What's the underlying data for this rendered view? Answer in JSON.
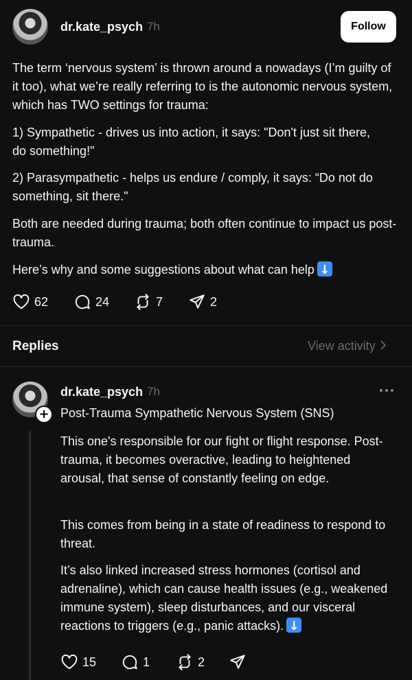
{
  "post": {
    "username": "dr.kate_psych",
    "time": "7h",
    "follow_label": "Follow",
    "paragraphs": [
      "The term ‘nervous system’ is thrown around a nowadays (I’m guilty of it too), what we’re really referring to is the autonomic nervous system, which has TWO settings for trauma:",
      "1) Sympathetic - drives us into action, it says: \"Don't just sit there, do something!\"",
      "2) Parasympathetic - helps us endure / comply, it says: “Do not do something, sit there.\"",
      "Both are needed during trauma; both often continue to impact us post-trauma.",
      "Here’s why and some suggestions about what can help"
    ],
    "actions": {
      "likes": "62",
      "comments": "24",
      "reposts": "7",
      "shares": "2"
    }
  },
  "replies_header": {
    "title": "Replies",
    "view_activity": "View activity"
  },
  "reply": {
    "username": "dr.kate_psych",
    "time": "7h",
    "title": "Post-Trauma Sympathetic Nervous System (SNS)",
    "paragraphs": [
      "This one's responsible for our fight or flight response. Post-trauma, it becomes overactive, leading to heightened arousal, that sense of constantly feeling on edge.",
      "This comes from being in a state of readiness to respond to threat.",
      "It’s also linked increased stress hormones (cortisol and adrenaline), which can cause health issues (e.g., weakened immune system), sleep disturbances, and our visceral reactions to triggers (e.g., panic attacks)."
    ],
    "actions": {
      "likes": "15",
      "comments": "1",
      "reposts": "2"
    }
  },
  "icons": [
    "heart-icon",
    "comment-icon",
    "repost-icon",
    "share-icon",
    "down-arrow-emoji-icon",
    "plus-icon",
    "more-icon",
    "chevron-right-icon"
  ],
  "colors": {
    "background": "#101010",
    "text": "#f3f5f7",
    "muted": "#6b6b6b",
    "emoji_blue": "#3b8ff3"
  }
}
